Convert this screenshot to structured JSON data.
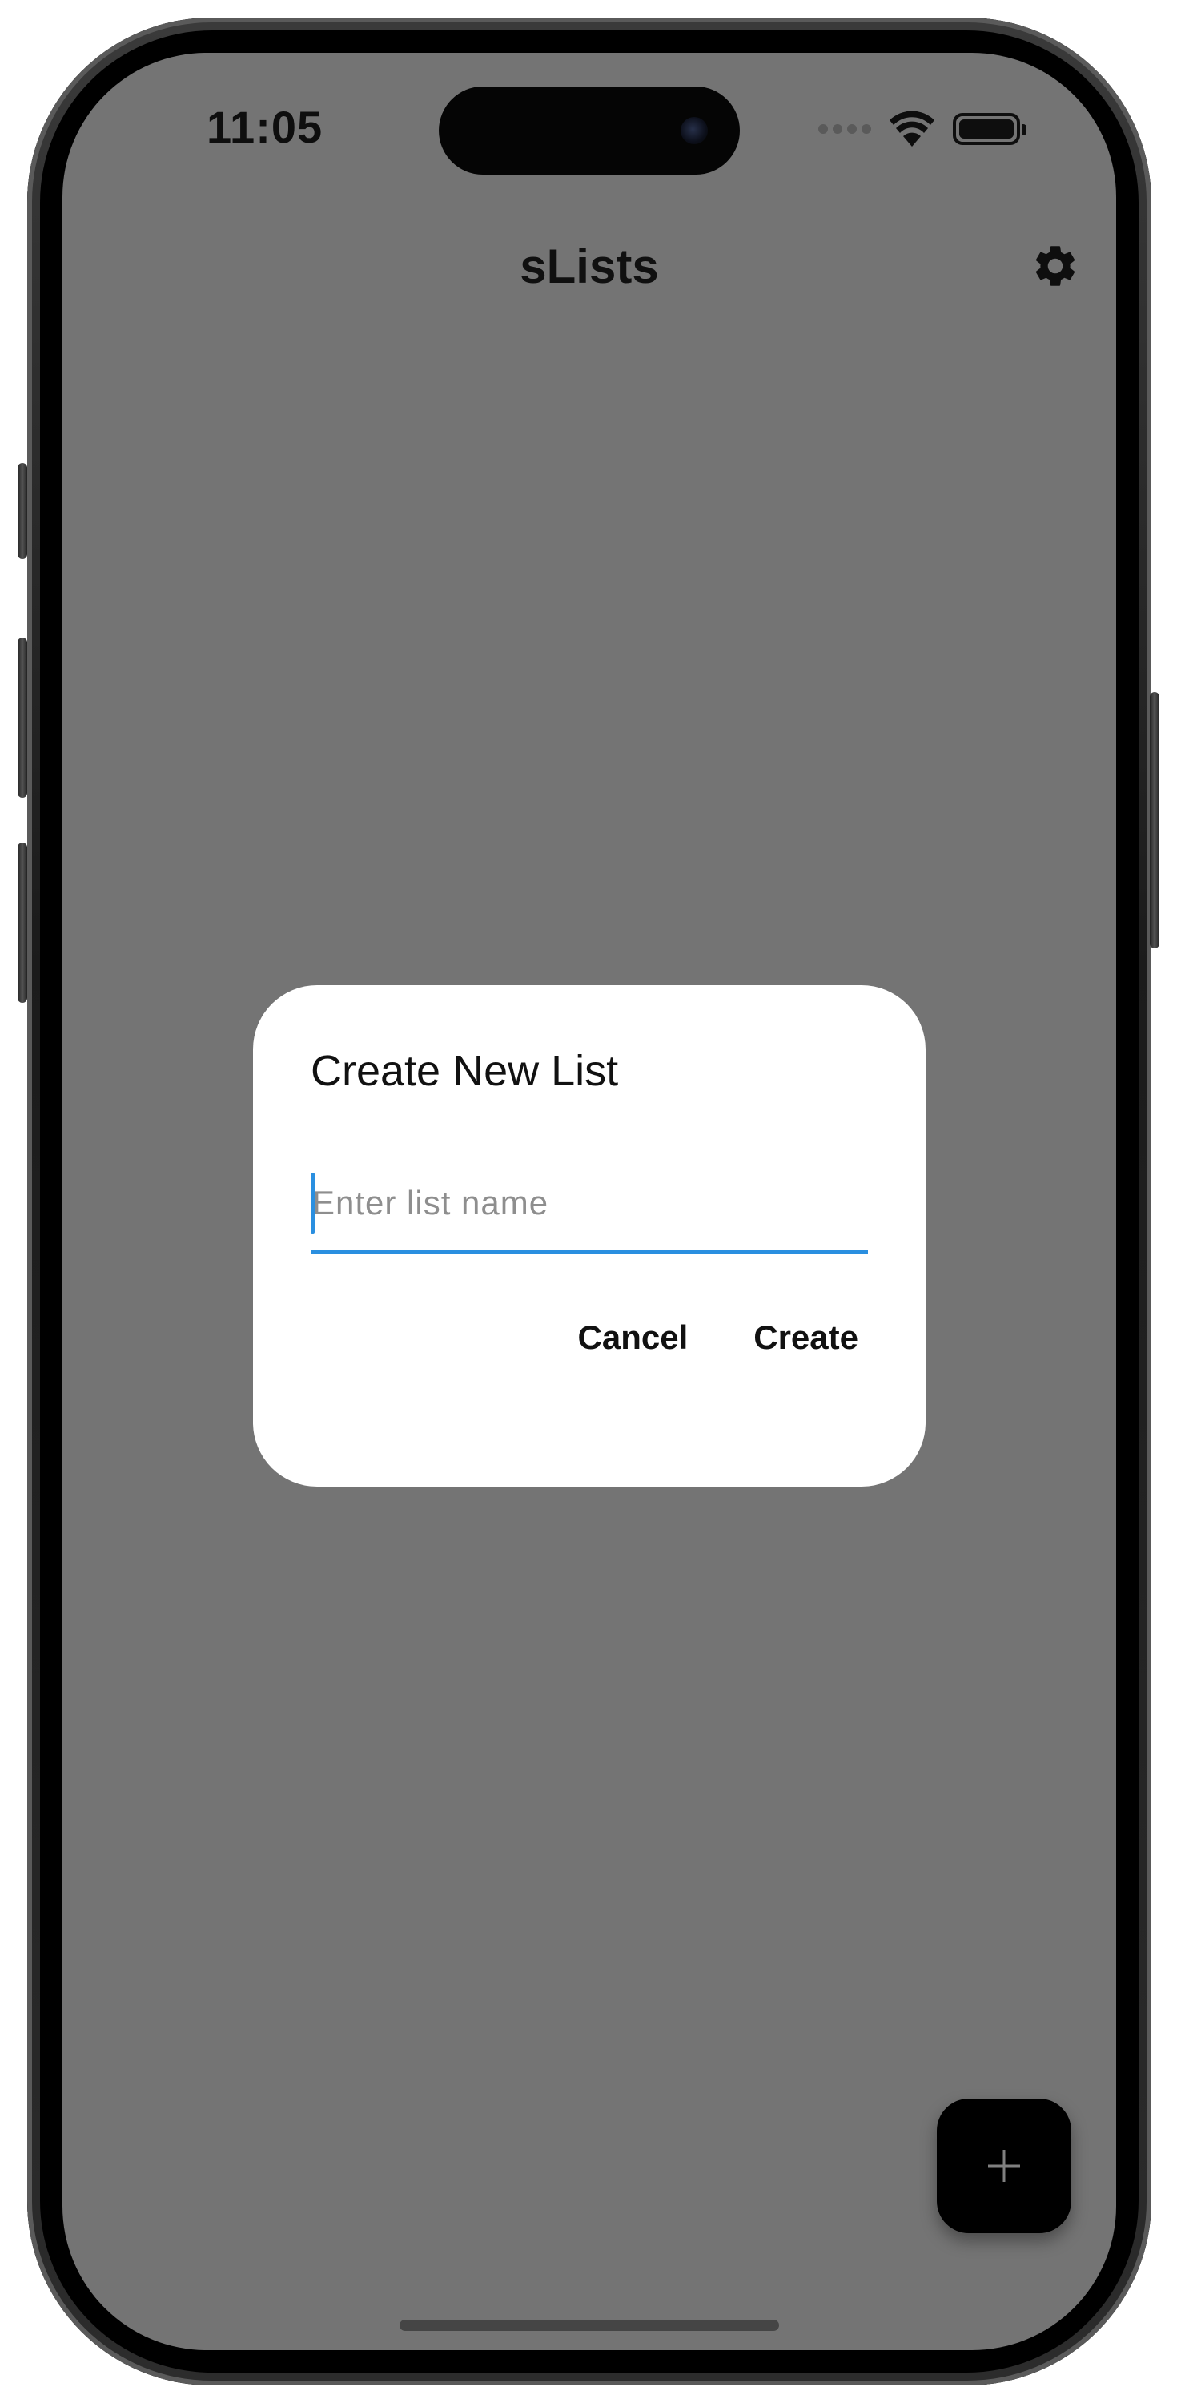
{
  "status_bar": {
    "time": "11:05"
  },
  "header": {
    "title": "sLists",
    "settings_icon": "gear-icon"
  },
  "dialog": {
    "title": "Create New List",
    "input_value": "",
    "input_placeholder": "Enter list name",
    "cancel_label": "Cancel",
    "create_label": "Create"
  },
  "fab": {
    "icon": "plus-icon",
    "icon_color": "#808080",
    "background": "#000000"
  },
  "colors": {
    "scrim": "#747474",
    "dialog_background": "#ffffff",
    "accent": "#2a8fe0",
    "text": "#111111"
  }
}
